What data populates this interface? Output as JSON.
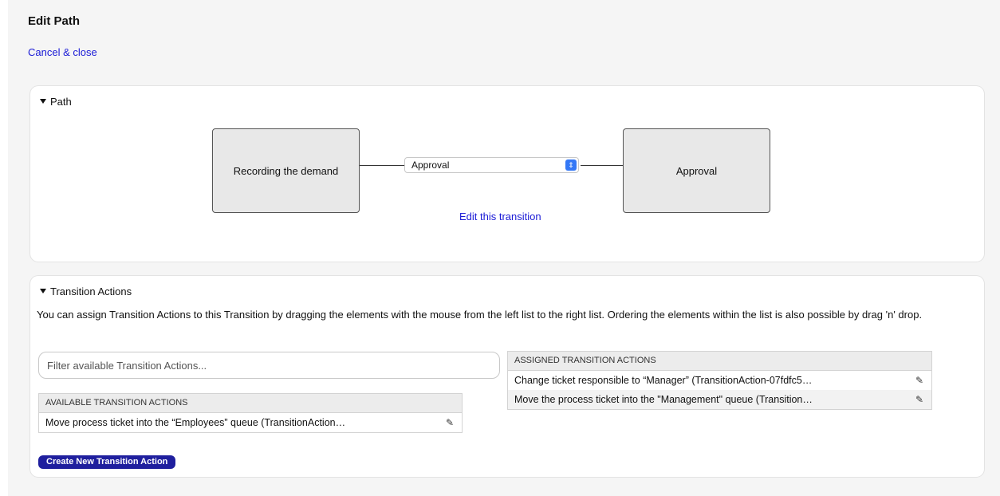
{
  "page": {
    "title": "Edit Path",
    "cancel_label": "Cancel & close"
  },
  "path_panel": {
    "header": "Path",
    "from_activity": "Recording the demand",
    "to_activity": "Approval",
    "transition_select_value": "Approval",
    "edit_transition_label": "Edit this transition"
  },
  "actions_panel": {
    "header": "Transition Actions",
    "description": "You can assign Transition Actions to this Transition by dragging the elements with the mouse from the left list to the right list. Ordering the elements within the list is also possible by drag 'n' drop.",
    "filter_placeholder": "Filter available Transition Actions...",
    "available": {
      "header": "AVAILABLE TRANSITION ACTIONS",
      "items": [
        "Move process ticket into the “Employees” queue (TransitionAction…"
      ]
    },
    "assigned": {
      "header": "ASSIGNED TRANSITION ACTIONS",
      "items": [
        "Change ticket responsible to “Manager” (TransitionAction-07fdfc5…",
        "Move the process ticket into the \"Management\" queue (Transition…"
      ]
    },
    "create_button_label": "Create New Transition Action"
  },
  "colors": {
    "link": "#1a1ad6",
    "primary_button": "#1f1f9e",
    "select_accent": "#3478f6"
  }
}
